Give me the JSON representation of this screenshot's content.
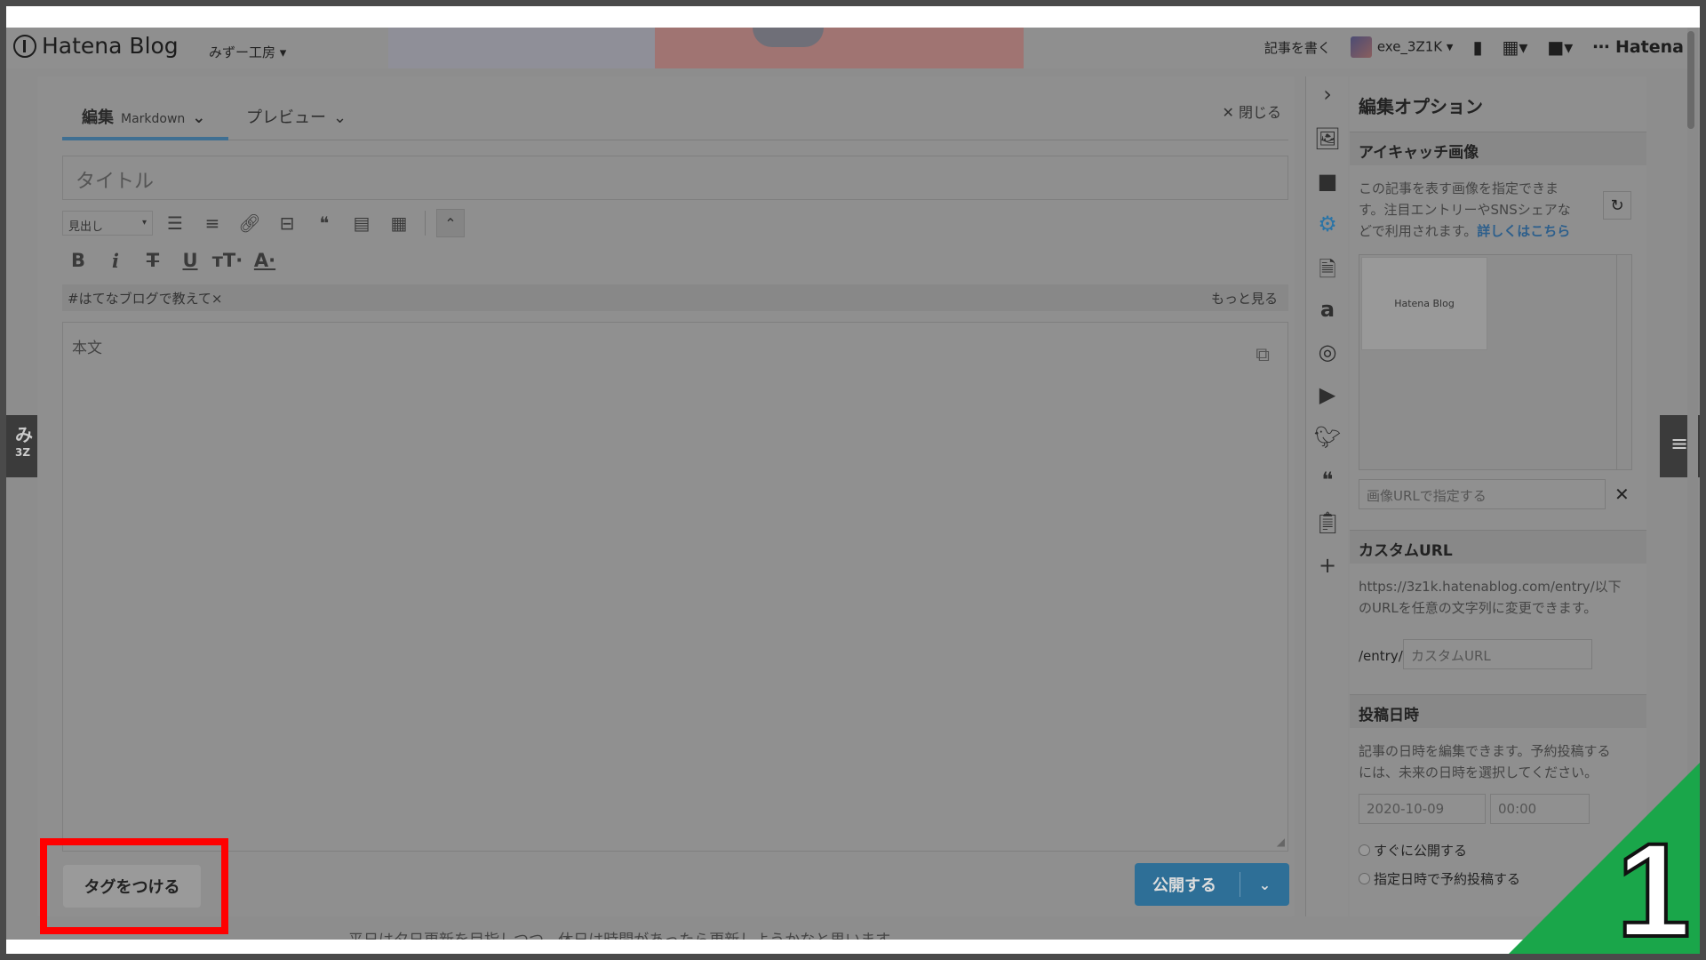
{
  "header": {
    "logo": "Hatena Blog",
    "blog_name": "みずー工房 ▾",
    "write_post": "記事を書く",
    "username": "exe_3Z1K ▾",
    "hatena": "Hatena"
  },
  "side": {
    "left_band": "み",
    "left_band_sub": "3Z",
    "bottom_text": "平日は夕日更新を目指しつつ、休日は時間があったら更新しようかなと思います"
  },
  "editor": {
    "tab_edit": "編集",
    "tab_edit_mode": "Markdown",
    "tab_preview": "プレビュー",
    "close": "✕ 閉じる",
    "title_placeholder": "タイトル",
    "heading_select": "見出し",
    "tag_text": "#はてなブログで教えて×",
    "more": "もっと見る",
    "body_placeholder": "本文",
    "tag_button": "タグをつける",
    "publish": "公開する"
  },
  "options": {
    "title": "編集オプション",
    "eyecatch": {
      "header": "アイキャッチ画像",
      "desc_line1": "この記事を表す画像を指定できま",
      "desc_line2": "す。注目エントリーやSNSシェアな",
      "desc_line3": "どで利用されます。",
      "link": "詳しくはこちら",
      "thumb_label": "Hatena Blog",
      "url_placeholder": "画像URLで指定する"
    },
    "custom_url": {
      "header": "カスタムURL",
      "desc_line1": "https://3z1k.hatenablog.com/entry/以下",
      "desc_line2": "のURLを任意の文字列に変更できます。",
      "prefix": "/entry/",
      "placeholder": "カスタムURL"
    },
    "post_date": {
      "header": "投稿日時",
      "desc_line1": "記事の日時を編集できます。予約投稿する",
      "desc_line2": "には、未来の日時を選択してください。",
      "date": "2020-10-09",
      "time": "00:00",
      "radio_now": "すぐに公開する",
      "radio_scheduled": "指定日時で予約投稿する"
    }
  },
  "step_number": "1",
  "colors": {
    "highlight": "#ff0000",
    "badge": "#1aa64a",
    "publish": "#2e6f97"
  }
}
